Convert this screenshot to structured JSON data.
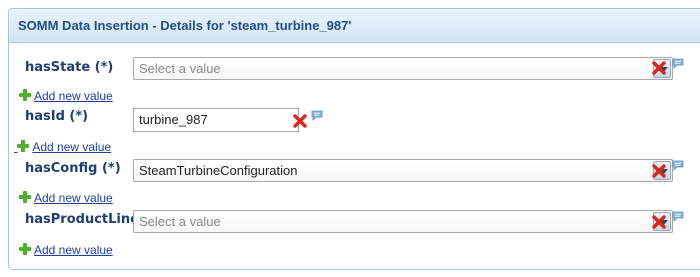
{
  "panel": {
    "title": "SOMM Data Insertion - Details for 'steam_turbine_987'"
  },
  "fields": {
    "hasState": {
      "label": "hasState (*)",
      "value": "",
      "placeholder": "Select a value",
      "add_label": "Add new value"
    },
    "hasId": {
      "label": "hasId (*)",
      "value": "turbine_987",
      "add_label": "Add new value"
    },
    "hasConfig": {
      "label": "hasConfig (*)",
      "value": "SteamTurbineConfiguration",
      "add_label": "Add new value"
    },
    "hasProductLine": {
      "label": "hasProductLine",
      "value": "",
      "placeholder": "Select a value",
      "add_label": "Add new value"
    }
  },
  "icons": {
    "add": "plus-icon",
    "delete": "red-x-icon",
    "note": "comment-icon"
  },
  "colors": {
    "header_text": "#1d4f87",
    "label_text": "#1f3f72",
    "link": "#1f3f9a",
    "delete": "#d9261c",
    "add": "#4fae2a",
    "note": "#8ab4de"
  }
}
